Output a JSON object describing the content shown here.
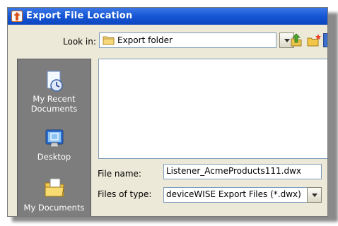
{
  "window": {
    "title": "Export File Location"
  },
  "lookin": {
    "label": "Look in:",
    "value": "Export folder"
  },
  "places": [
    {
      "label": "My Recent\nDocuments",
      "icon": "recent-documents-icon"
    },
    {
      "label": "Desktop",
      "icon": "desktop-icon"
    },
    {
      "label": "My Documents",
      "icon": "my-documents-icon"
    }
  ],
  "filename": {
    "label": "File name:",
    "value": "Listener_AcmeProducts111.dwx"
  },
  "filetype": {
    "label": "Files of type:",
    "value": "deviceWISE Export Files (*.dwx)"
  },
  "colors": {
    "titlebar": "#0d46c0",
    "places_bar": "#7d7d7d",
    "dialog_bg": "#ece9d8"
  }
}
